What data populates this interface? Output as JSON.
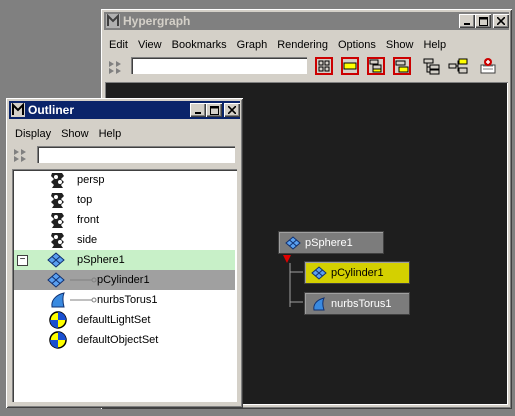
{
  "hypergraph": {
    "title": "Hypergraph",
    "menu": [
      "Edit",
      "View",
      "Bookmarks",
      "Graph",
      "Rendering",
      "Options",
      "Show",
      "Help"
    ],
    "search_value": "",
    "nodes": {
      "parent": "pSphere1",
      "child1": "pCylinder1",
      "child2": "nurbsTorus1"
    }
  },
  "outliner": {
    "title": "Outliner",
    "menu": [
      "Display",
      "Show",
      "Help"
    ],
    "search_value": "",
    "items": [
      {
        "label": "persp",
        "icon": "camera-icon"
      },
      {
        "label": "top",
        "icon": "camera-icon"
      },
      {
        "label": "front",
        "icon": "camera-icon"
      },
      {
        "label": "side",
        "icon": "camera-icon"
      },
      {
        "label": "pSphere1",
        "icon": "mesh-icon",
        "expand": "−"
      },
      {
        "label": "pCylinder1",
        "icon": "mesh-icon"
      },
      {
        "label": "nurbsTorus1",
        "icon": "nurbs-icon"
      },
      {
        "label": "defaultLightSet",
        "icon": "set-icon"
      },
      {
        "label": "defaultObjectSet",
        "icon": "set-icon"
      }
    ]
  },
  "colors": {
    "selected_node": "#d4d000",
    "highlight_row": "#c8f0c8",
    "selected_row": "#a0a0a0",
    "graph_bg": "#1e1e1e"
  }
}
